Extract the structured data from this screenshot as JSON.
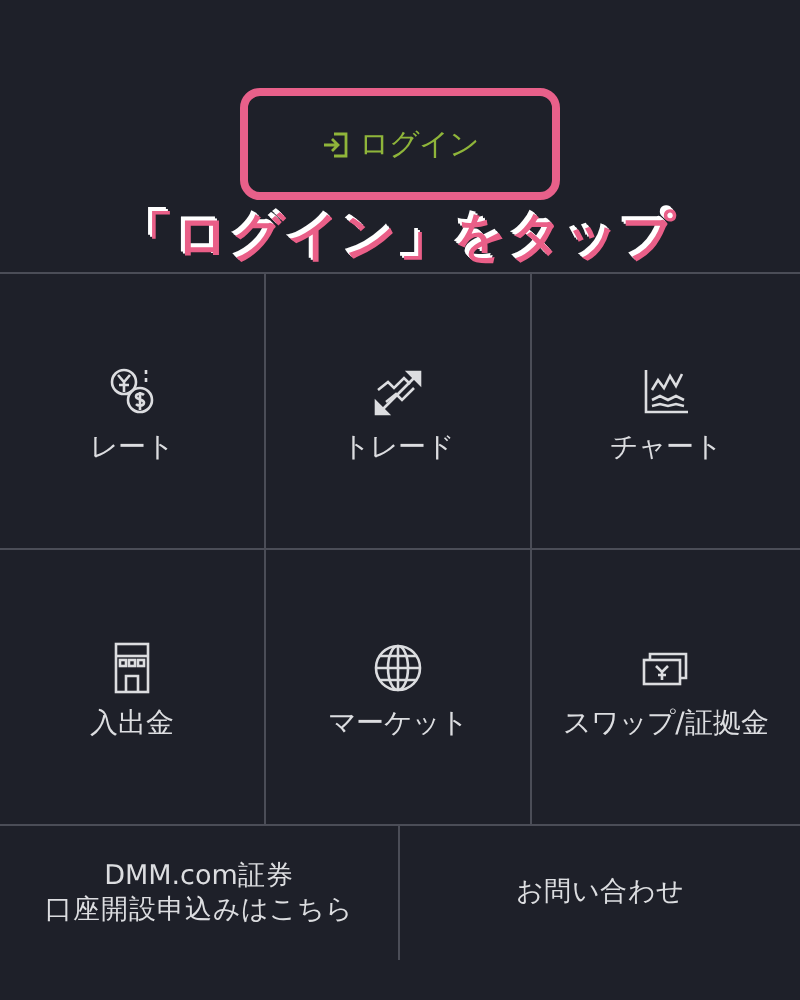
{
  "login_button": {
    "label": "ログイン"
  },
  "annotation": {
    "text": "「ログイン」をタップ"
  },
  "menu": [
    {
      "label": "レート"
    },
    {
      "label": "トレード"
    },
    {
      "label": "チャート"
    },
    {
      "label": "入出金"
    },
    {
      "label": "マーケット"
    },
    {
      "label": "スワップ/証拠金"
    }
  ],
  "footer_links": [
    {
      "lines": [
        "DMM.com証券",
        "口座開設申込みはこちら"
      ]
    },
    {
      "lines": [
        "お問い合わせ"
      ]
    }
  ]
}
